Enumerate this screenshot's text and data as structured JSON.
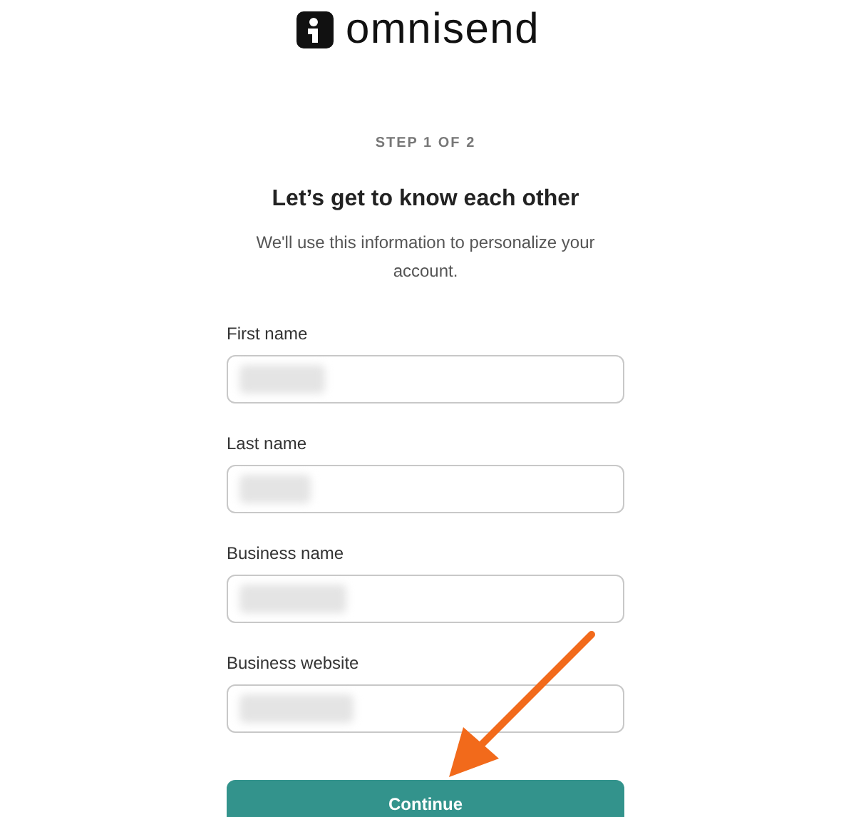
{
  "brand": {
    "name": "omnisend"
  },
  "step": "STEP 1 OF 2",
  "heading": "Let’s get to know each other",
  "subtitle": "We'll use this information to personalize your account.",
  "fields": [
    {
      "label": "First name"
    },
    {
      "label": "Last name"
    },
    {
      "label": "Business name"
    },
    {
      "label": "Business website"
    }
  ],
  "button": "Continue"
}
